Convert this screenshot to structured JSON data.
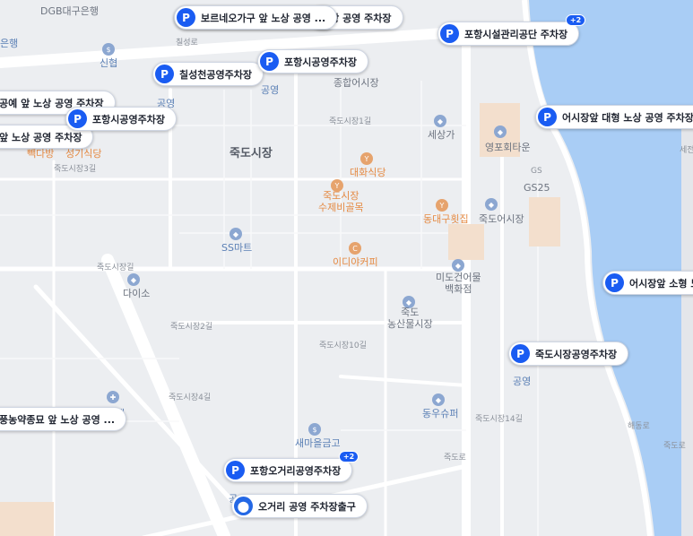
{
  "streets": {
    "s1": "칠성로",
    "s2": "죽도시장1길",
    "s3": "죽도시장3길",
    "s4": "죽도시장길",
    "s5": "죽도시장2길",
    "s6": "죽도시장10길",
    "s7": "죽도시장4길",
    "s8": "죽도시장14길",
    "s9": "죽도로",
    "s10": "해동로",
    "s11": "죽도로"
  },
  "places": {
    "jukdo_market": "죽도시장",
    "dgb": "DGB대구은행",
    "bank_left": "은행",
    "sinhan": "신협",
    "gongyeong1": "공영",
    "gongyeong2": "공영",
    "jonghap": "종합어시장",
    "sesangga": "세상가",
    "yeongpo": "영포회타운",
    "gs25": "GS25",
    "daehwa": "대화식당",
    "sujebi": "죽도시장\n수제비골목",
    "jukdo_fish": "죽도어시장",
    "donggu": "동대구횟집",
    "sseongi": "성기식당",
    "baekdabang": "빽다방",
    "ssmart": "SS마트",
    "ediya": "이디야커피",
    "daiso": "다이소",
    "mido": "미도건어물\n백화점",
    "nongsan": "죽도\n농산물시장",
    "gongyeong3": "공영",
    "dongwoo": "동우슈퍼",
    "saemaeul": "새마을금고",
    "bank_bottom": "행",
    "gongyeong4": "공",
    "sejeon": "세전"
  },
  "parking": [
    {
      "label": "보르네오가구 앞 노상 공영 ...",
      "icon": "P",
      "badge": ""
    },
    {
      "label": "노상 공영 주차장",
      "icon": "P",
      "badge": ""
    },
    {
      "label": "포항시설관리공단 주차장",
      "icon": "P",
      "badge": "+2"
    },
    {
      "label": "칠성천공영주차장",
      "icon": "P",
      "badge": ""
    },
    {
      "label": "포항시공영주차장",
      "icon": "P",
      "badge": ""
    },
    {
      "label": "공예 앞 노상 공영 주차장",
      "icon": "",
      "badge": ""
    },
    {
      "label": "포항시공영주차장",
      "icon": "P",
      "badge": ""
    },
    {
      "label": "앞 노상 공영 주차장",
      "icon": "",
      "badge": ""
    },
    {
      "label": "어시장앞 대형 노상 공영 주차장",
      "icon": "P",
      "badge": ""
    },
    {
      "label": "어시장앞 소형 노",
      "icon": "P",
      "badge": ""
    },
    {
      "label": "죽도시장공영주차장",
      "icon": "P",
      "badge": ""
    },
    {
      "label": "풍농약종묘 앞 노상 공영 ...",
      "icon": "",
      "badge": ""
    },
    {
      "label": "포항오거리공영주차장",
      "icon": "P",
      "badge": "+2"
    },
    {
      "label": "오거리 공영 주차장출구",
      "icon": "",
      "badge": ""
    }
  ],
  "colors": {
    "river": "#a9cdf5",
    "road": "#ffffff",
    "block": "#e9ebef",
    "accent": "#1a5cf2",
    "poi_food": "#e6a36d"
  }
}
